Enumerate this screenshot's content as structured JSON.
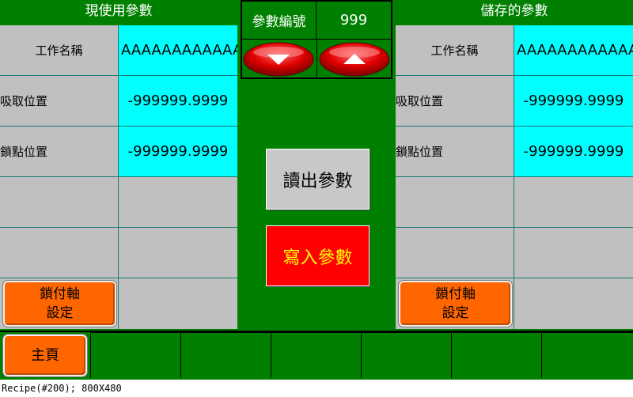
{
  "left_panel": {
    "header": "現使用參數",
    "rows": [
      {
        "label": "工作名稱",
        "value": "AAAAAAAAAAAA"
      },
      {
        "label": "吸取位置",
        "value": "-999999.9999"
      },
      {
        "label": "鎖點位置",
        "value": "-999999.9999"
      }
    ],
    "button_line1": "鎖付軸",
    "button_line2": "設定"
  },
  "right_panel": {
    "header": "儲存的參數",
    "rows": [
      {
        "label": "工作名稱",
        "value": "AAAAAAAAAAAA"
      },
      {
        "label": "吸取位置",
        "value": "-999999.9999"
      },
      {
        "label": "鎖點位置",
        "value": "-999999.9999"
      }
    ],
    "button_line1": "鎖付軸",
    "button_line2": "設定"
  },
  "center": {
    "param_number_label": "參數編號",
    "param_number_value": "999",
    "read_button": "讀出參數",
    "write_button": "寫入參數"
  },
  "nav": {
    "home_button": "主頁"
  },
  "status_bar": "Recipe(#200); 800X480",
  "colors": {
    "background": "#008000",
    "value_cell": "#00ffff",
    "label_cell": "#c0c0c0",
    "orange_button": "#ff6600",
    "write_button": "#ff0000",
    "write_text": "#ffff00"
  }
}
